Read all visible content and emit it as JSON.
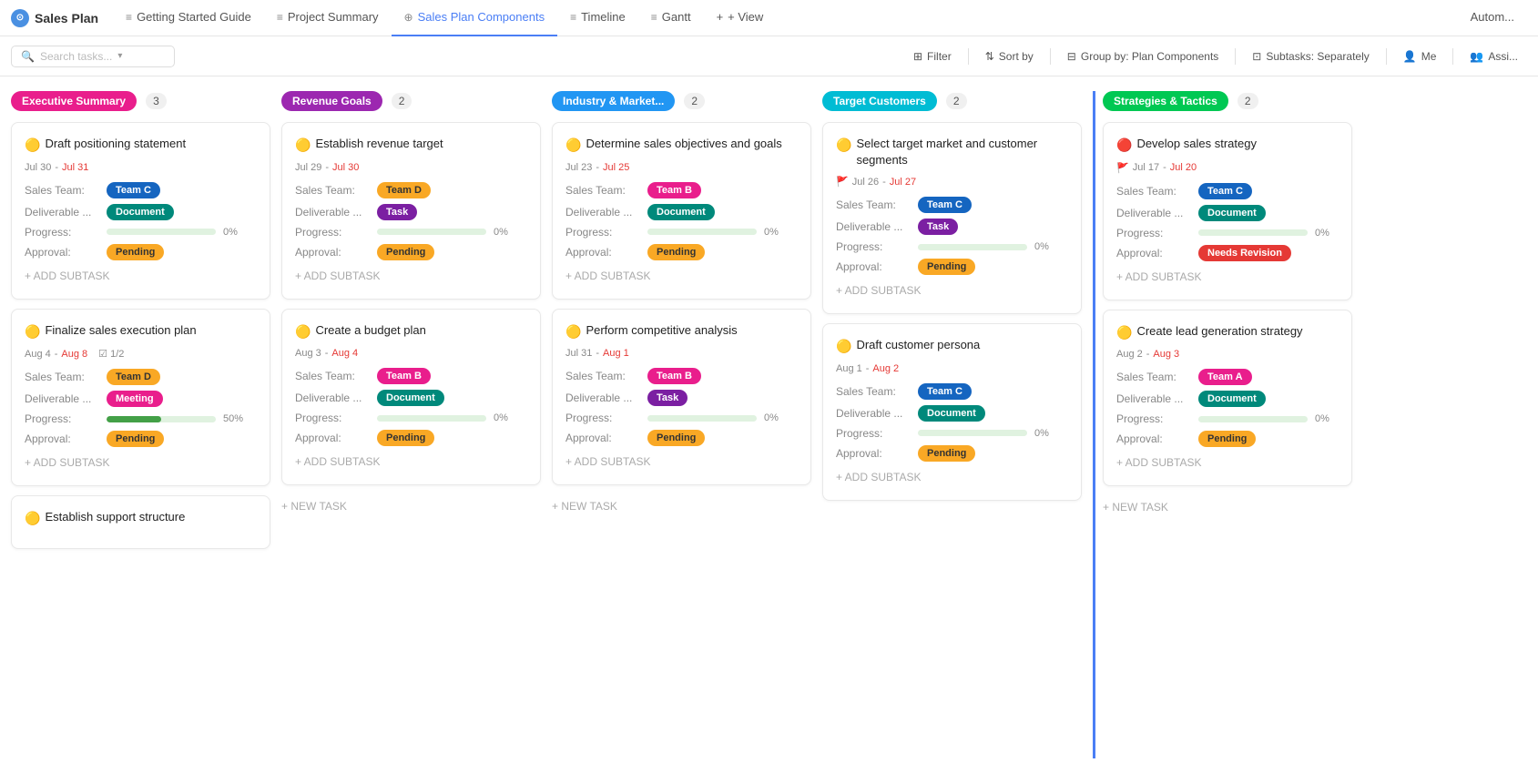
{
  "app": {
    "title": "Sales Plan"
  },
  "nav": {
    "tabs": [
      {
        "id": "sales-plan",
        "label": "Sales Plan",
        "icon": "⊙",
        "active": false
      },
      {
        "id": "getting-started",
        "label": "Getting Started Guide",
        "icon": "≡",
        "active": false
      },
      {
        "id": "project-summary",
        "label": "Project Summary",
        "icon": "≡",
        "active": false
      },
      {
        "id": "sales-plan-components",
        "label": "Sales Plan Components",
        "icon": "⊕",
        "active": true
      },
      {
        "id": "timeline",
        "label": "Timeline",
        "icon": "≡",
        "active": false
      },
      {
        "id": "gantt",
        "label": "Gantt",
        "icon": "≡",
        "active": false
      }
    ],
    "view_btn": "+ View",
    "autom_btn": "Autom..."
  },
  "toolbar": {
    "search_placeholder": "Search tasks...",
    "filter_label": "Filter",
    "sort_by_label": "Sort by",
    "group_by_label": "Group by: Plan Components",
    "subtasks_label": "Subtasks: Separately",
    "me_label": "Me",
    "assignees_label": "Assi..."
  },
  "columns": [
    {
      "id": "executive-summary",
      "label": "Executive Summary",
      "label_color": "#e91e8c",
      "count": 3,
      "cards": [
        {
          "id": "draft-positioning",
          "title": "Draft positioning statement",
          "title_icon": "🟡",
          "date_start": "Jul 30",
          "date_end": "Jul 31",
          "date_end_red": true,
          "flag": false,
          "sales_team_label": "Sales Team:",
          "sales_team_value": "Team C",
          "sales_team_badge_class": "badge-team-c",
          "deliverable_label": "Deliverable ...",
          "deliverable_value": "Document",
          "deliverable_badge_class": "badge-document",
          "progress_label": "Progress:",
          "progress_pct": 0,
          "approval_label": "Approval:",
          "approval_value": "Pending",
          "approval_badge_class": "badge-pending",
          "add_subtask": "+ ADD SUBTASK",
          "checkbox_count": null
        },
        {
          "id": "finalize-sales",
          "title": "Finalize sales execution plan",
          "title_icon": "🟡",
          "date_start": "Aug 4",
          "date_end": "Aug 8",
          "date_end_red": true,
          "flag": false,
          "checkbox_count": "1/2",
          "sales_team_label": "Sales Team:",
          "sales_team_value": "Team D",
          "sales_team_badge_class": "badge-team-d",
          "deliverable_label": "Deliverable ...",
          "deliverable_value": "Meeting",
          "deliverable_badge_class": "badge-meeting",
          "progress_label": "Progress:",
          "progress_pct": 50,
          "approval_label": "Approval:",
          "approval_value": "Pending",
          "approval_badge_class": "badge-pending",
          "add_subtask": "+ ADD SUBTASK",
          "new_task": null
        },
        {
          "id": "establish-support",
          "title": "Establish support structure",
          "title_icon": "🟡",
          "date_start": null,
          "date_end": null,
          "date_end_red": false,
          "flag": false,
          "sales_team_label": null,
          "sales_team_value": null,
          "deliverable_label": null,
          "deliverable_value": null,
          "progress_label": null,
          "progress_pct": null,
          "approval_label": null,
          "approval_value": null,
          "add_subtask": null,
          "partial": true
        }
      ]
    },
    {
      "id": "revenue-goals",
      "label": "Revenue Goals",
      "label_color": "#9c27b0",
      "count": 2,
      "cards": [
        {
          "id": "establish-revenue",
          "title": "Establish revenue target",
          "title_icon": "🟡",
          "date_start": "Jul 29",
          "date_end": "Jul 30",
          "date_end_red": true,
          "flag": false,
          "sales_team_label": "Sales Team:",
          "sales_team_value": "Team D",
          "sales_team_badge_class": "badge-team-d",
          "deliverable_label": "Deliverable ...",
          "deliverable_value": "Task",
          "deliverable_badge_class": "badge-task",
          "progress_label": "Progress:",
          "progress_pct": 0,
          "approval_label": "Approval:",
          "approval_value": "Pending",
          "approval_badge_class": "badge-pending",
          "add_subtask": "+ ADD SUBTASK"
        },
        {
          "id": "create-budget",
          "title": "Create a budget plan",
          "title_icon": "🟡",
          "date_start": "Aug 3",
          "date_end": "Aug 4",
          "date_end_red": true,
          "flag": false,
          "sales_team_label": "Sales Team:",
          "sales_team_value": "Team B",
          "sales_team_badge_class": "badge-team-b",
          "deliverable_label": "Deliverable ...",
          "deliverable_value": "Document",
          "deliverable_badge_class": "badge-document",
          "progress_label": "Progress:",
          "progress_pct": 0,
          "approval_label": "Approval:",
          "approval_value": "Pending",
          "approval_badge_class": "badge-pending",
          "add_subtask": "+ ADD SUBTASK",
          "new_task": "+ NEW TASK"
        }
      ]
    },
    {
      "id": "industry-market",
      "label": "Industry & Market...",
      "label_color": "#2196f3",
      "count": 2,
      "cards": [
        {
          "id": "determine-sales",
          "title": "Determine sales objectives and goals",
          "title_icon": "🟡",
          "date_start": "Jul 23",
          "date_end": "Jul 25",
          "date_end_red": true,
          "flag": false,
          "sales_team_label": "Sales Team:",
          "sales_team_value": "Team B",
          "sales_team_badge_class": "badge-team-b",
          "deliverable_label": "Deliverable ...",
          "deliverable_value": "Document",
          "deliverable_badge_class": "badge-document",
          "progress_label": "Progress:",
          "progress_pct": 0,
          "approval_label": "Approval:",
          "approval_value": "Pending",
          "approval_badge_class": "badge-pending",
          "add_subtask": "+ ADD SUBTASK"
        },
        {
          "id": "perform-competitive",
          "title": "Perform competitive analysis",
          "title_icon": "🟡",
          "date_start": "Jul 31",
          "date_end": "Aug 1",
          "date_end_red": true,
          "flag": false,
          "sales_team_label": "Sales Team:",
          "sales_team_value": "Team B",
          "sales_team_badge_class": "badge-team-b",
          "deliverable_label": "Deliverable ...",
          "deliverable_value": "Task",
          "deliverable_badge_class": "badge-task",
          "progress_label": "Progress:",
          "progress_pct": 0,
          "approval_label": "Approval:",
          "approval_value": "Pending",
          "approval_badge_class": "badge-pending",
          "add_subtask": "+ ADD SUBTASK",
          "new_task": "+ NEW TASK"
        }
      ]
    },
    {
      "id": "target-customers",
      "label": "Target Customers",
      "label_color": "#00bcd4",
      "count": 2,
      "cards": [
        {
          "id": "select-target",
          "title": "Select target market and customer segments",
          "title_icon": "🟡",
          "date_start": "Jul 26",
          "date_end": "Jul 27",
          "date_end_red": true,
          "flag": true,
          "sales_team_label": "Sales Team:",
          "sales_team_value": "Team C",
          "sales_team_badge_class": "badge-team-c",
          "deliverable_label": "Deliverable ...",
          "deliverable_value": "Task",
          "deliverable_badge_class": "badge-task",
          "progress_label": "Progress:",
          "progress_pct": 0,
          "approval_label": "Approval:",
          "approval_value": "Pending",
          "approval_badge_class": "badge-pending",
          "add_subtask": "+ ADD SUBTASK"
        },
        {
          "id": "draft-customer",
          "title": "Draft customer persona",
          "title_icon": "🟡",
          "date_start": "Aug 1",
          "date_end": "Aug 2",
          "date_end_red": true,
          "flag": false,
          "sales_team_label": "Sales Team:",
          "sales_team_value": "Team C",
          "sales_team_badge_class": "badge-team-c",
          "deliverable_label": "Deliverable ...",
          "deliverable_value": "Document",
          "deliverable_badge_class": "badge-document",
          "progress_label": "Progress:",
          "progress_pct": 0,
          "approval_label": "Approval:",
          "approval_value": "Pending",
          "approval_badge_class": "badge-pending",
          "add_subtask": "+ ADD SUBTASK"
        }
      ]
    },
    {
      "id": "strategies-tactics",
      "label": "Strategies & Tactics",
      "label_color": "#00c853",
      "count": 2,
      "left_border": true,
      "cards": [
        {
          "id": "develop-sales-strategy",
          "title": "Develop sales strategy",
          "title_icon": "🔴",
          "date_start": "Jul 17",
          "date_end": "Jul 20",
          "date_end_red": true,
          "flag": true,
          "sales_team_label": "Sales Team:",
          "sales_team_value": "Team C",
          "sales_team_badge_class": "badge-team-c",
          "deliverable_label": "Deliverable ...",
          "deliverable_value": "Document",
          "deliverable_badge_class": "badge-document",
          "progress_label": "Progress:",
          "progress_pct": 0,
          "approval_label": "Approval:",
          "approval_value": "Needs Revision",
          "approval_badge_class": "badge-needs-revision",
          "add_subtask": "+ ADD SUBTASK"
        },
        {
          "id": "create-lead-generation",
          "title": "Create lead generation strategy",
          "title_icon": "🟡",
          "date_start": "Aug 2",
          "date_end": "Aug 3",
          "date_end_red": true,
          "flag": false,
          "sales_team_label": "Sales Team:",
          "sales_team_value": "Team A",
          "sales_team_badge_class": "badge-team-a",
          "deliverable_label": "Deliverable ...",
          "deliverable_value": "Document",
          "deliverable_badge_class": "badge-document",
          "progress_label": "Progress:",
          "progress_pct": 0,
          "approval_label": "Approval:",
          "approval_value": "Pending",
          "approval_badge_class": "badge-pending",
          "add_subtask": "+ ADD SUBTASK",
          "new_task": "+ NEW TASK"
        }
      ]
    }
  ]
}
